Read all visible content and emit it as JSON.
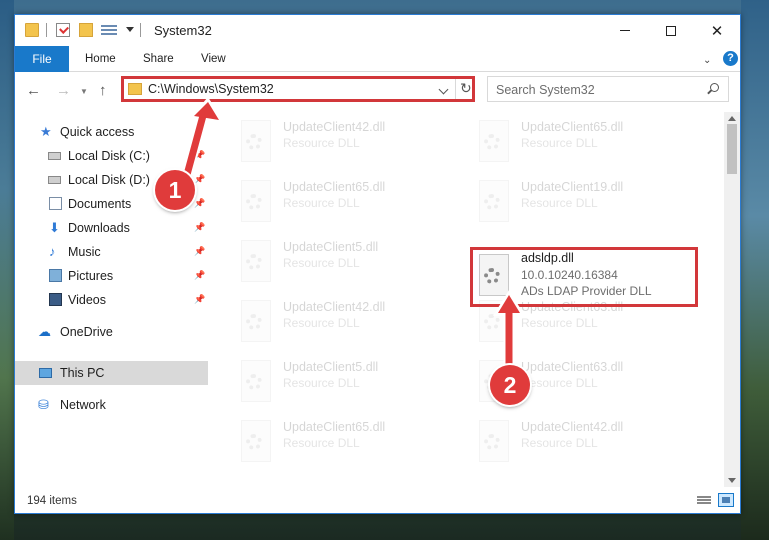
{
  "window": {
    "title": "System32"
  },
  "ribbon": {
    "file_label": "File",
    "tabs": [
      "Home",
      "Share",
      "View"
    ],
    "help": "?"
  },
  "address": {
    "path": "C:\\Windows\\System32",
    "refresh": "↻"
  },
  "search": {
    "placeholder": "Search System32"
  },
  "navigation": {
    "items": [
      {
        "label": "Quick access",
        "icon": "star-icon"
      },
      {
        "label": "Local Disk (C:)",
        "icon": "drive-icon"
      },
      {
        "label": "Local Disk (D:)",
        "icon": "drive-icon"
      },
      {
        "label": "Documents",
        "icon": "documents-icon"
      },
      {
        "label": "Downloads",
        "icon": "download-icon"
      },
      {
        "label": "Music",
        "icon": "music-icon"
      },
      {
        "label": "Pictures",
        "icon": "pictures-icon"
      },
      {
        "label": "Videos",
        "icon": "videos-icon"
      },
      {
        "label": "OneDrive",
        "icon": "cloud-icon"
      },
      {
        "label": "This PC",
        "icon": "computer-icon"
      },
      {
        "label": "Network",
        "icon": "network-icon"
      }
    ]
  },
  "files": [
    {
      "name": "UpdateClient42.dll",
      "type": "Resource DLL"
    },
    {
      "name": "UpdateClient65.dll",
      "type": "Resource DLL"
    },
    {
      "name": "UpdateClient65.dll",
      "type": "Resource DLL"
    },
    {
      "name": "UpdateClient19.dll",
      "type": "Resource DLL"
    },
    {
      "name": "UpdateClient5.dll",
      "type": "Resource DLL"
    },
    {
      "name": "adsldp.dll",
      "version": "10.0.10240.16384",
      "type": "ADs LDAP Provider DLL"
    },
    {
      "name": "UpdateClient42.dll",
      "type": "Resource DLL"
    },
    {
      "name": "UpdateClient63.dll",
      "type": "Resource DLL"
    },
    {
      "name": "UpdateClient5.dll",
      "type": "Resource DLL"
    },
    {
      "name": "UpdateClient63.dll",
      "type": "Resource DLL"
    },
    {
      "name": "UpdateClient65.dll",
      "type": "Resource DLL"
    },
    {
      "name": "UpdateClient42.dll",
      "type": "Resource DLL"
    }
  ],
  "status": {
    "item_count": "194 items"
  },
  "annotations": {
    "step1": "1",
    "step2": "2",
    "color": "#e03b3b"
  }
}
